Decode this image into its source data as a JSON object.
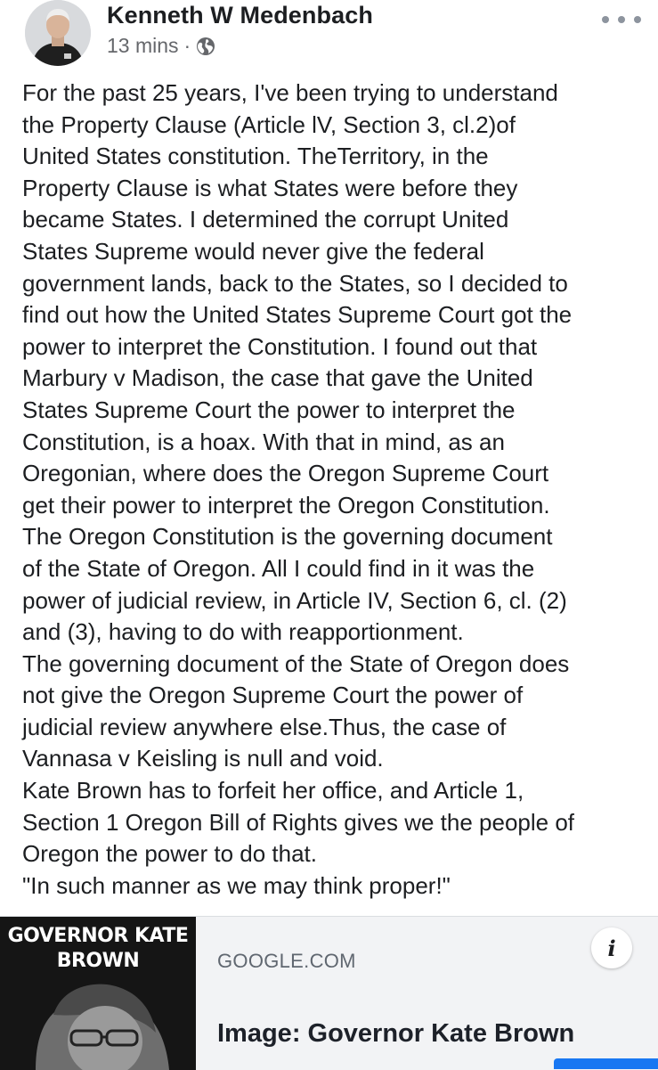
{
  "post": {
    "author_name": "Kenneth W Medenbach",
    "timestamp": "13 mins",
    "separator": "·",
    "privacy_icon": "globe-icon",
    "more_icon": "more-options-icon",
    "body_lines": [
      "For the past 25 years, I've been trying to understand",
      "the Property Clause (Article lV, Section 3, cl.2)of",
      "United States constitution. TheTerritory, in the",
      "Property Clause is what States were before they",
      "became States. I determined the corrupt United",
      "States Supreme would never give the federal",
      "government lands,  back to the States, so I decided to",
      "find out how the United States Supreme Court got the",
      "power to interpret the Constitution. I found out that",
      "Marbury v Madison, the case that gave the United",
      "States Supreme Court the power to interpret the",
      "Constitution, is a hoax. With that in mind, as an",
      "Oregonian, where does the Oregon Supreme Court",
      "get their power to interpret the Oregon Constitution.",
      "The Oregon Constitution is the governing document",
      "of the State of Oregon. All I could find in it was the",
      "power of judicial review, in Article IV, Section 6, cl. (2)",
      "and (3), having to do with reapportionment.",
      "The governing document of the State of Oregon does",
      "not give the Oregon Supreme Court the power of",
      "judicial review anywhere else.Thus, the case of",
      "Vannasa v Keisling is null and void.",
      "Kate Brown has to forfeit her office, and Article 1,",
      "Section 1 Oregon Bill of Rights gives we the people of",
      "Oregon the power to do that.",
      "\"In such manner as we may think proper!\""
    ]
  },
  "link_card": {
    "thumbnail_caption_line1": "GOVERNOR KATE",
    "thumbnail_caption_line2": "BROWN",
    "domain": "GOOGLE.COM",
    "title": "Image: Governor Kate Brown",
    "info_label": "i"
  },
  "colors": {
    "text_primary": "#1c1e21",
    "text_secondary": "#65676b",
    "card_background": "#f2f3f5",
    "accent_blue": "#1877f2"
  }
}
